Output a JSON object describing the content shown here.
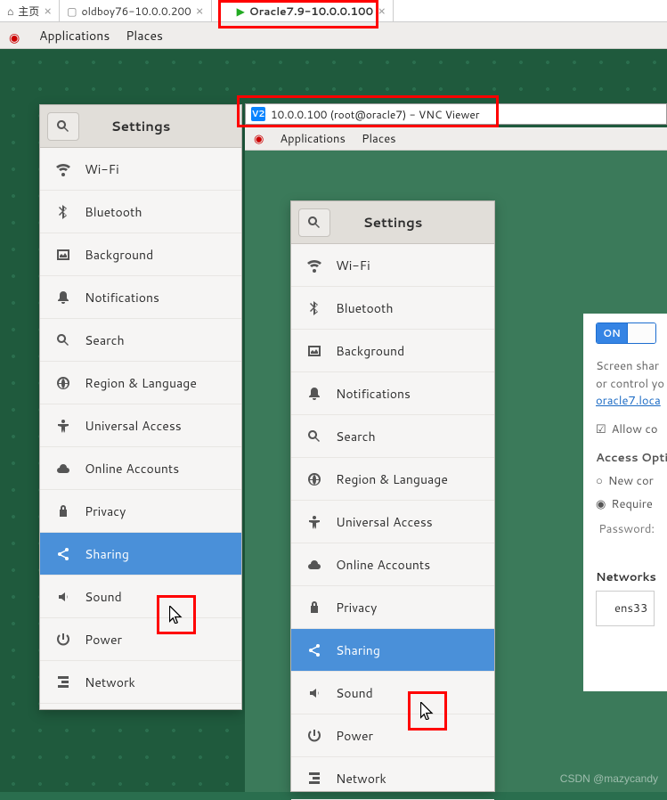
{
  "tabs": [
    {
      "icon": "home",
      "label": "主页"
    },
    {
      "icon": "vm-off",
      "label": "oldboy76-10.0.0.200"
    },
    {
      "icon": "vm-on",
      "label": "Oracle7.9-10.0.0.100"
    }
  ],
  "host_menubar": {
    "applications": "Applications",
    "places": "Places"
  },
  "settings1": {
    "title": "Settings",
    "items": [
      {
        "icon": "wifi",
        "label": "Wi-Fi"
      },
      {
        "icon": "bluetooth",
        "label": "Bluetooth"
      },
      {
        "icon": "background",
        "label": "Background"
      },
      {
        "icon": "bell",
        "label": "Notifications"
      },
      {
        "icon": "search",
        "label": "Search"
      },
      {
        "icon": "globe",
        "label": "Region & Language"
      },
      {
        "icon": "universal",
        "label": "Universal Access"
      },
      {
        "icon": "cloud",
        "label": "Online Accounts"
      },
      {
        "icon": "privacy",
        "label": "Privacy"
      },
      {
        "icon": "share",
        "label": "Sharing",
        "selected": true
      },
      {
        "icon": "sound",
        "label": "Sound"
      },
      {
        "icon": "power",
        "label": "Power"
      },
      {
        "icon": "network",
        "label": "Network"
      }
    ]
  },
  "vnc": {
    "title": "10.0.0.100 (root@oracle7) - VNC Viewer"
  },
  "vnc_menubar": {
    "applications": "Applications",
    "places": "Places"
  },
  "settings2": {
    "title": "Settings",
    "items": [
      {
        "icon": "wifi",
        "label": "Wi-Fi"
      },
      {
        "icon": "bluetooth",
        "label": "Bluetooth"
      },
      {
        "icon": "background",
        "label": "Background"
      },
      {
        "icon": "bell",
        "label": "Notifications"
      },
      {
        "icon": "search",
        "label": "Search"
      },
      {
        "icon": "globe",
        "label": "Region & Language"
      },
      {
        "icon": "universal",
        "label": "Universal Access"
      },
      {
        "icon": "cloud",
        "label": "Online Accounts"
      },
      {
        "icon": "privacy",
        "label": "Privacy"
      },
      {
        "icon": "share",
        "label": "Sharing",
        "selected": true
      },
      {
        "icon": "sound",
        "label": "Sound"
      },
      {
        "icon": "power",
        "label": "Power"
      },
      {
        "icon": "network",
        "label": "Network"
      }
    ]
  },
  "sharing": {
    "toggle": "ON",
    "desc1": "Screen shar",
    "desc2": "or control yo",
    "link": "oracle7.loca",
    "allow": "Allow co",
    "access_h": "Access Opti",
    "opt_new": "New cor",
    "opt_req": "Require",
    "password_lbl": "Password:",
    "networks_h": "Networks",
    "net_name": "ens33"
  },
  "watermark": "CSDN @mazycandy"
}
